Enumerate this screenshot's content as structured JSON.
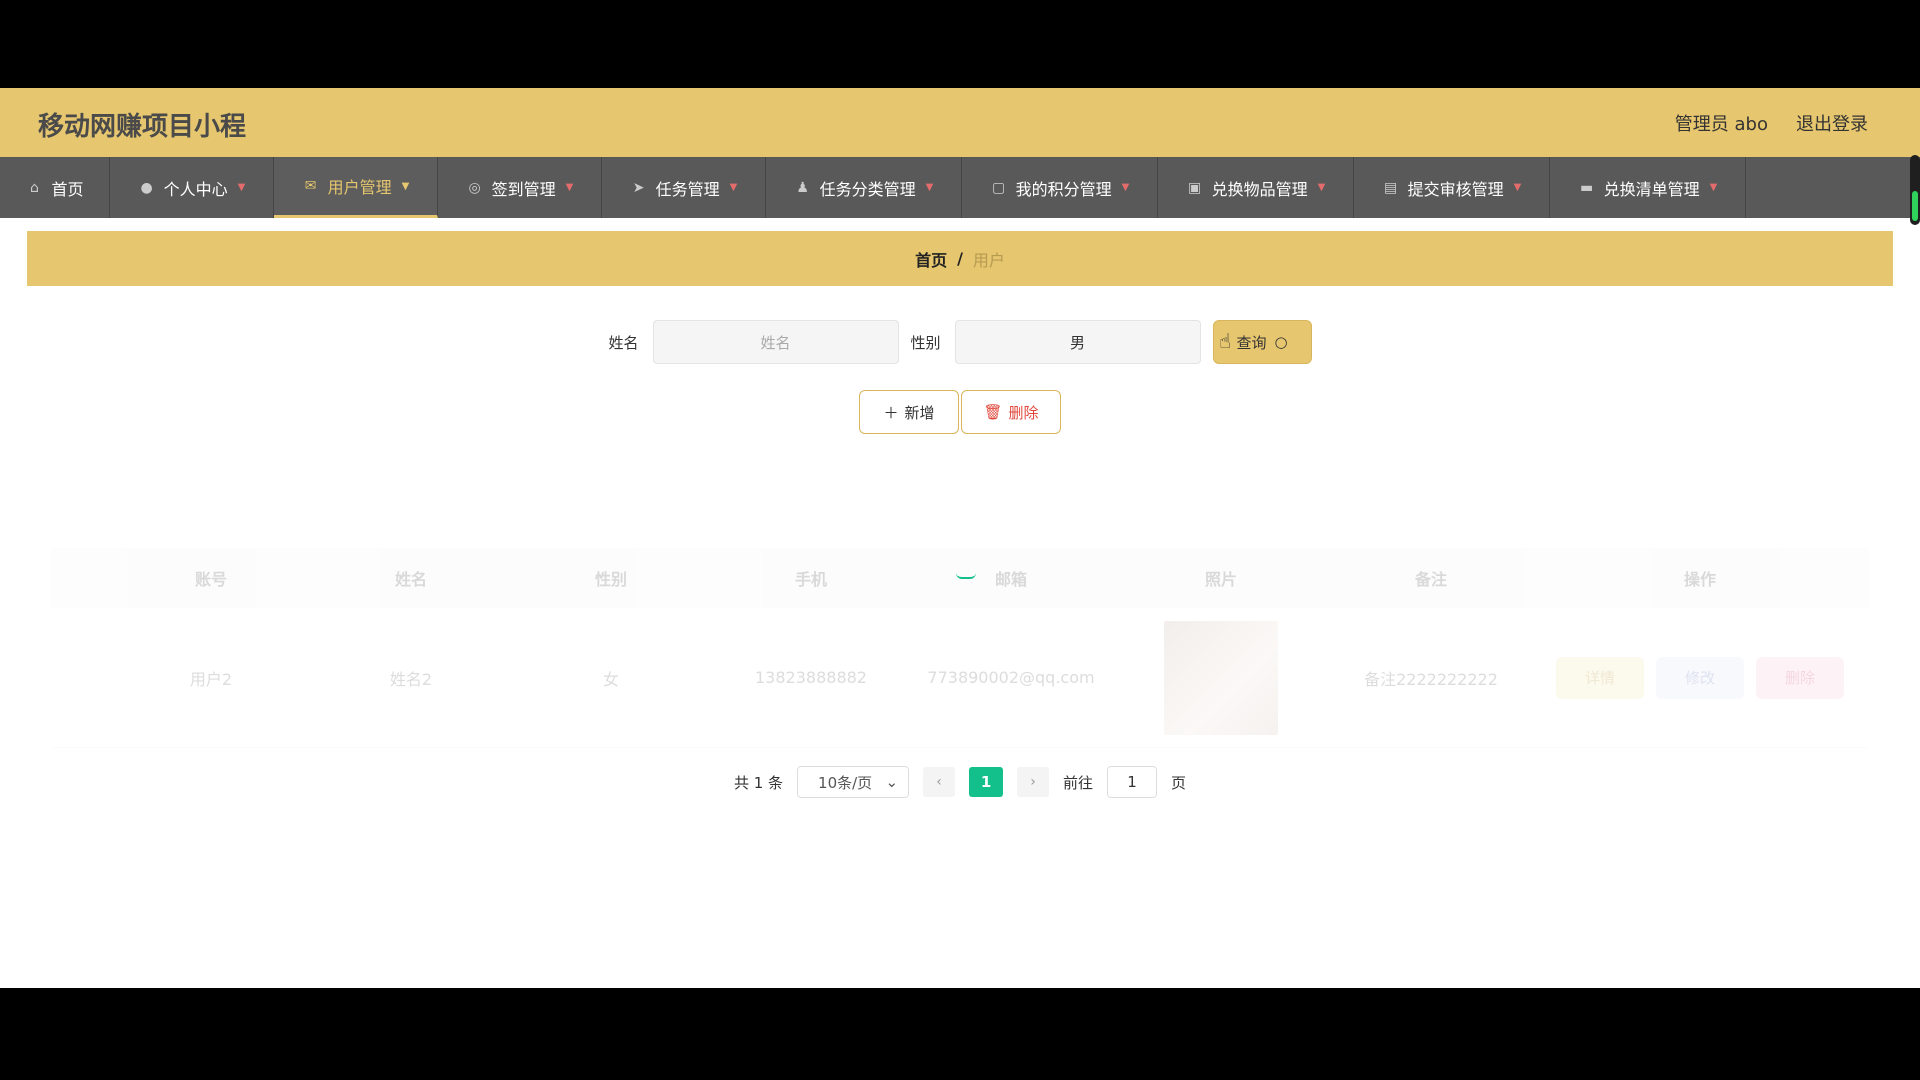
{
  "header": {
    "title": "移动网赚项目小程",
    "admin_label": "管理员 abo",
    "logout_label": "退出登录"
  },
  "nav": [
    {
      "label": "首页",
      "icon": "home-icon"
    },
    {
      "label": "个人中心",
      "icon": "user-icon"
    },
    {
      "label": "用户管理",
      "icon": "mail-icon",
      "active": true
    },
    {
      "label": "签到管理",
      "icon": "compass-icon"
    },
    {
      "label": "任务管理",
      "icon": "send-icon"
    },
    {
      "label": "任务分类管理",
      "icon": "person-icon"
    },
    {
      "label": "我的积分管理",
      "icon": "crop-icon"
    },
    {
      "label": "兑换物品管理",
      "icon": "briefcase-icon"
    },
    {
      "label": "提交审核管理",
      "icon": "clipboard-icon"
    },
    {
      "label": "兑换清单管理",
      "icon": "monitor-icon"
    }
  ],
  "breadcrumb": {
    "home": "首页",
    "separator": "/",
    "current": "用户"
  },
  "search": {
    "name_label": "姓名",
    "name_placeholder": "姓名",
    "gender_label": "性别",
    "gender_value": "男",
    "query_label": "查询"
  },
  "actions": {
    "add_label": "新增",
    "delete_label": "删除"
  },
  "table": {
    "headers": [
      "账号",
      "姓名",
      "性别",
      "手机",
      "邮箱",
      "照片",
      "备注",
      "操作"
    ],
    "rows": [
      {
        "account": "用户2",
        "name": "姓名2",
        "gender": "女",
        "phone": "13823888882",
        "email": "773890002@qq.com",
        "remark": "备注2222222222",
        "ops": [
          "详情",
          "修改",
          "删除"
        ]
      }
    ]
  },
  "pagination": {
    "total": "共 1 条",
    "page_size": "10条/页",
    "current_page": "1",
    "goto_label": "前往",
    "goto_value": "1",
    "page_suffix": "页"
  }
}
